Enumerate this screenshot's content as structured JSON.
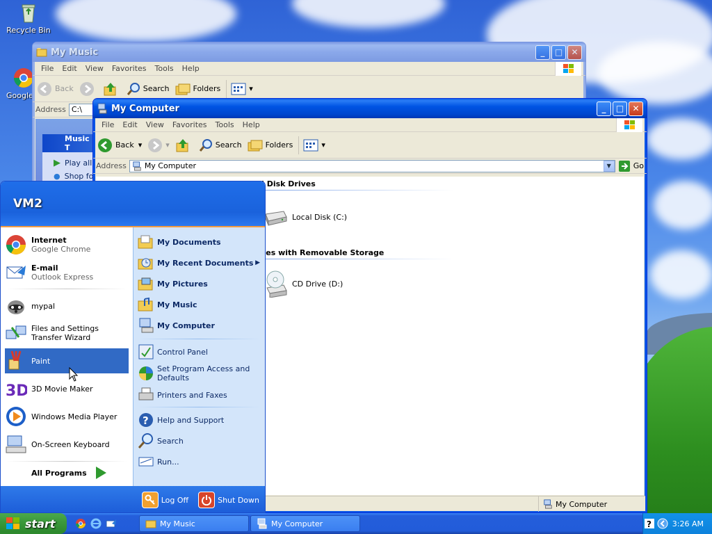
{
  "desktop": {
    "icons": [
      {
        "label": "Recycle Bin"
      },
      {
        "label": "Google C"
      }
    ]
  },
  "music_window": {
    "title": "My Music",
    "menu": [
      "File",
      "Edit",
      "View",
      "Favorites",
      "Tools",
      "Help"
    ],
    "toolbar": {
      "back": "Back",
      "search": "Search",
      "folders": "Folders"
    },
    "address_label": "Address",
    "address_value": "C:\\",
    "tasks_title": "Music T",
    "tasks": [
      "Play all",
      "Shop fo"
    ]
  },
  "computer_window": {
    "title": "My Computer",
    "menu": [
      "File",
      "Edit",
      "View",
      "Favorites",
      "Tools",
      "Help"
    ],
    "toolbar": {
      "back": "Back",
      "search": "Search",
      "folders": "Folders"
    },
    "address_label": "Address",
    "address_value": "My Computer",
    "go_label": "Go",
    "groups": [
      {
        "title": "d Disk Drives",
        "items": [
          "Local Disk (C:)"
        ]
      },
      {
        "title": "ices with Removable Storage",
        "items": [
          "CD Drive (D:)"
        ]
      }
    ],
    "status": "My Computer"
  },
  "start_menu": {
    "user": "VM2",
    "pinned": [
      {
        "title": "Internet",
        "sub": "Google Chrome"
      },
      {
        "title": "E-mail",
        "sub": "Outlook Express"
      }
    ],
    "recent": [
      {
        "label": "mypal"
      },
      {
        "label": "Files and Settings Transfer Wizard"
      },
      {
        "label": "Paint"
      },
      {
        "label": "3D Movie Maker"
      },
      {
        "label": "Windows Media Player"
      },
      {
        "label": "On-Screen Keyboard"
      }
    ],
    "all_programs": "All Programs",
    "right": [
      {
        "label": "My Documents"
      },
      {
        "label": "My Recent Documents"
      },
      {
        "label": "My Pictures"
      },
      {
        "label": "My Music"
      },
      {
        "label": "My Computer"
      },
      {
        "label": "Control Panel"
      },
      {
        "label": "Set Program Access and Defaults"
      },
      {
        "label": "Printers and Faxes"
      },
      {
        "label": "Help and Support"
      },
      {
        "label": "Search"
      },
      {
        "label": "Run..."
      }
    ],
    "log_off": "Log Off",
    "shut_down": "Shut Down"
  },
  "taskbar": {
    "start": "start",
    "tasks": [
      {
        "label": "My Music"
      },
      {
        "label": "My Computer"
      }
    ],
    "clock": "3:26 AM"
  }
}
